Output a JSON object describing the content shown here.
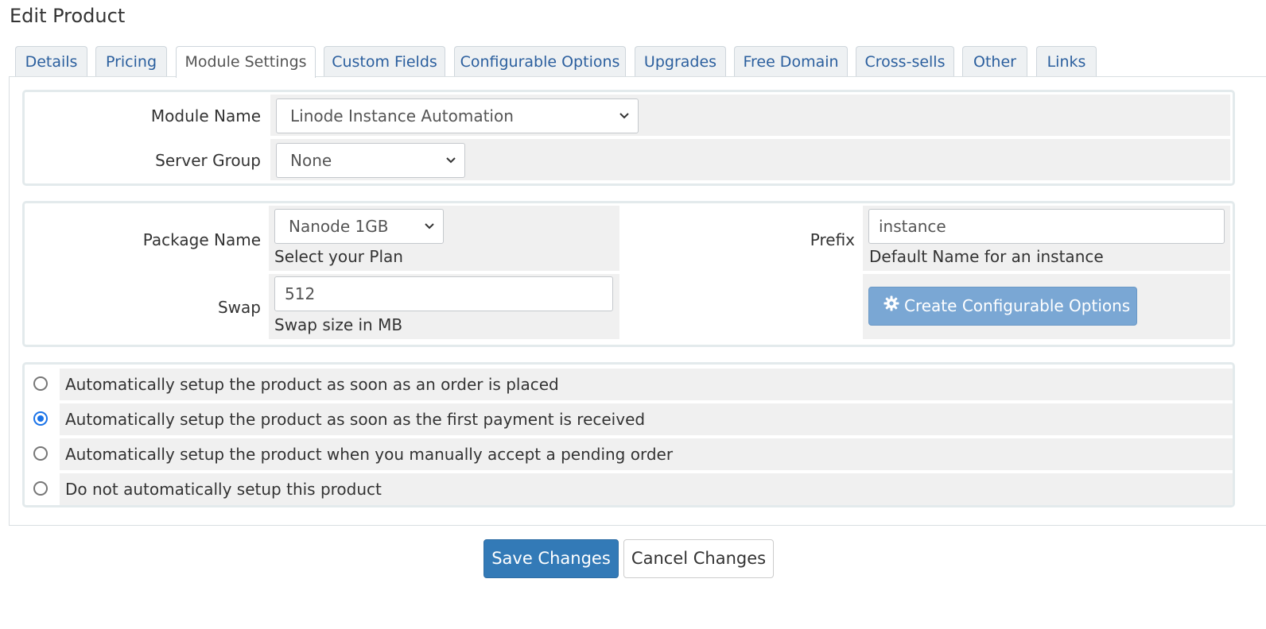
{
  "page": {
    "title": "Edit Product"
  },
  "tabs": [
    {
      "label": "Details"
    },
    {
      "label": "Pricing"
    },
    {
      "label": "Module Settings",
      "active": true
    },
    {
      "label": "Custom Fields"
    },
    {
      "label": "Configurable Options"
    },
    {
      "label": "Upgrades"
    },
    {
      "label": "Free Domain"
    },
    {
      "label": "Cross-sells"
    },
    {
      "label": "Other"
    },
    {
      "label": "Links"
    }
  ],
  "module": {
    "module_name_label": "Module Name",
    "module_name_value": "Linode Instance Automation",
    "server_group_label": "Server Group",
    "server_group_value": "None"
  },
  "config": {
    "package_name_label": "Package Name",
    "package_name_value": "Nanode 1GB",
    "package_name_help": "Select your Plan",
    "prefix_label": "Prefix",
    "prefix_value": "instance",
    "prefix_help": "Default Name for an instance",
    "swap_label": "Swap",
    "swap_value": "512",
    "swap_help": "Swap size in MB",
    "create_options_label": "Create Configurable Options"
  },
  "setup_options": [
    {
      "label": "Automatically setup the product as soon as an order is placed",
      "checked": false
    },
    {
      "label": "Automatically setup the product as soon as the first payment is received",
      "checked": true
    },
    {
      "label": "Automatically setup the product when you manually accept a pending order",
      "checked": false
    },
    {
      "label": "Do not automatically setup this product",
      "checked": false
    }
  ],
  "actions": {
    "save_label": "Save Changes",
    "cancel_label": "Cancel Changes"
  },
  "colors": {
    "primary": "#337ab7",
    "tab_link": "#2b5f9e",
    "cell_bg": "#f0f0f0",
    "radio_checked": "#1a73e8"
  }
}
